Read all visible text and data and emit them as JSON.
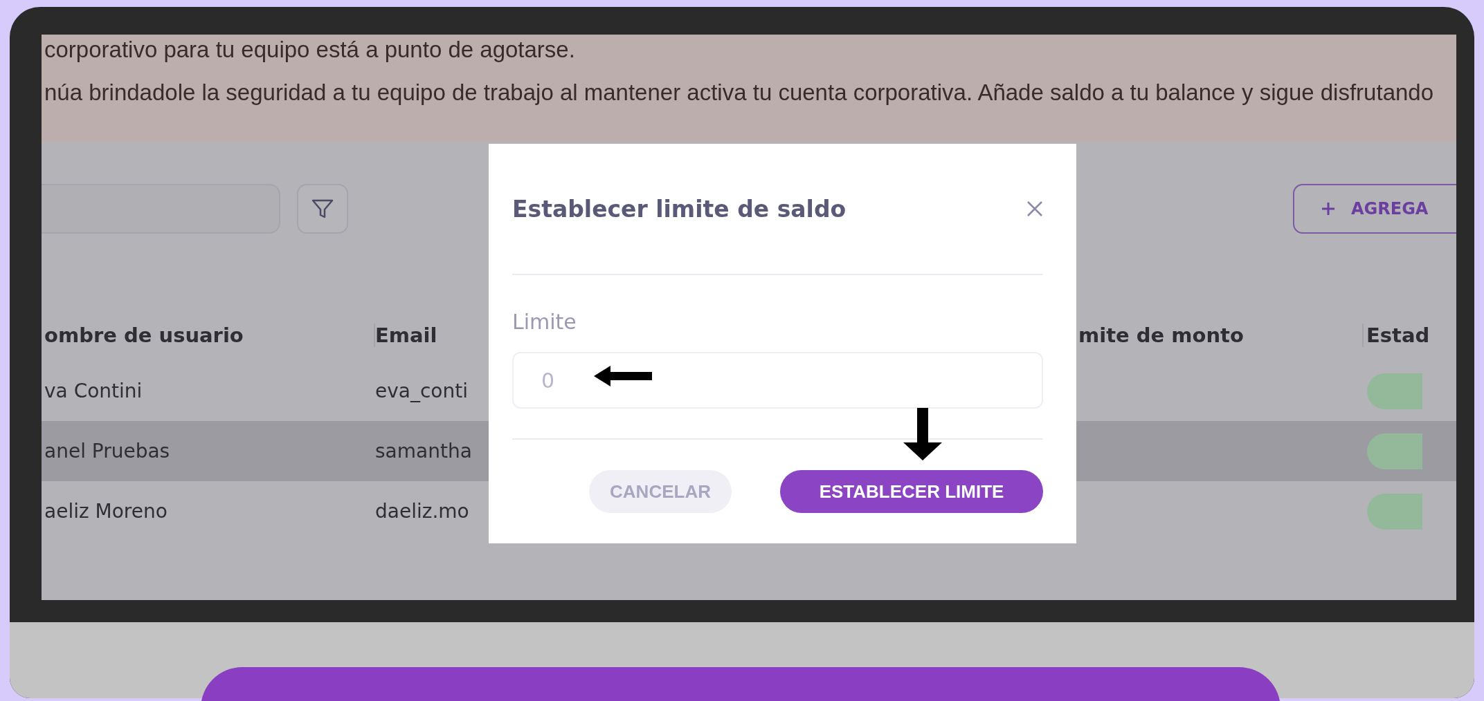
{
  "alert": {
    "lines": [
      "corporativo para tu equipo está a punto de agotarse.",
      "núa brindadole la seguridad a tu equipo de trabajo al mantener activa tu cuenta corporativa. Añade saldo a tu balance y sigue disfrutando"
    ]
  },
  "toolbar": {
    "add_button": "AGREGA"
  },
  "table": {
    "columns": [
      "ombre de usuario",
      "Email",
      "mite de monto",
      "Estad"
    ],
    "rows": [
      {
        "cells": [
          "va Contini",
          "eva_conti"
        ],
        "selected": false
      },
      {
        "cells": [
          "anel Pruebas",
          "samantha"
        ],
        "selected": true
      },
      {
        "cells": [
          "aeliz Moreno",
          "daeliz.mo"
        ],
        "selected": false
      }
    ]
  },
  "modal": {
    "title": "Establecer limite de saldo",
    "label": "Limite",
    "placeholder": "0",
    "buttons": [
      {
        "label": "CANCELAR",
        "kind": "secondary"
      },
      {
        "label": "ESTABLECER LIMITE",
        "kind": "primary"
      }
    ]
  }
}
